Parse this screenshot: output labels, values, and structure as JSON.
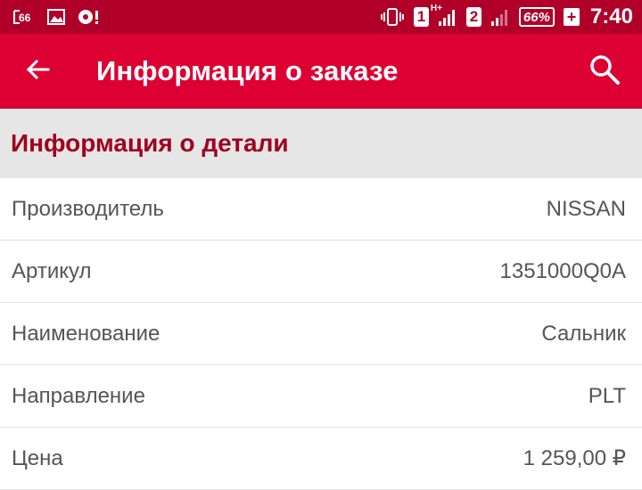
{
  "status_bar": {
    "left_badge": "66",
    "sim1": "1",
    "network": "H+",
    "sim2": "2",
    "battery": "66%",
    "charge": "+",
    "time": "7:40"
  },
  "app_bar": {
    "title": "Информация о заказе"
  },
  "section": {
    "title": "Информация о детали"
  },
  "details": [
    {
      "label": "Производитель",
      "value": "NISSAN"
    },
    {
      "label": "Артикул",
      "value": "1351000Q0A"
    },
    {
      "label": "Наименование",
      "value": "Сальник"
    },
    {
      "label": "Направление",
      "value": "PLT"
    },
    {
      "label": "Цена",
      "value": "1 259,00 ₽"
    }
  ],
  "colors": {
    "status_bar": "#b0002a",
    "app_bar": "#dc0033",
    "section_title": "#a0001c",
    "section_bg": "#e6e6e6"
  },
  "icons": {
    "back": "arrow-back-icon",
    "search": "search-icon"
  }
}
